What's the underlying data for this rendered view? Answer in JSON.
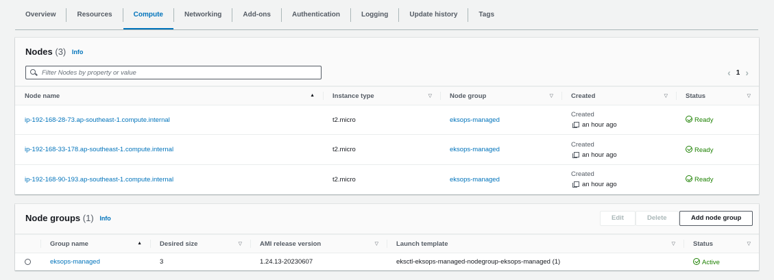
{
  "tabs": [
    {
      "label": "Overview"
    },
    {
      "label": "Resources"
    },
    {
      "label": "Compute",
      "active": true
    },
    {
      "label": "Networking"
    },
    {
      "label": "Add-ons"
    },
    {
      "label": "Authentication"
    },
    {
      "label": "Logging"
    },
    {
      "label": "Update history"
    },
    {
      "label": "Tags"
    }
  ],
  "nodes": {
    "title": "Nodes",
    "count": "(3)",
    "info": "Info",
    "search_placeholder": "Filter Nodes by property or value",
    "page": "1",
    "columns": [
      "Node name",
      "Instance type",
      "Node group",
      "Created",
      "Status"
    ],
    "rows": [
      {
        "name": "ip-192-168-28-73.ap-southeast-1.compute.internal",
        "instance_type": "t2.micro",
        "node_group": "eksops-managed",
        "created_label": "Created",
        "created": "an hour ago",
        "status": "Ready"
      },
      {
        "name": "ip-192-168-33-178.ap-southeast-1.compute.internal",
        "instance_type": "t2.micro",
        "node_group": "eksops-managed",
        "created_label": "Created",
        "created": "an hour ago",
        "status": "Ready"
      },
      {
        "name": "ip-192-168-90-193.ap-southeast-1.compute.internal",
        "instance_type": "t2.micro",
        "node_group": "eksops-managed",
        "created_label": "Created",
        "created": "an hour ago",
        "status": "Ready"
      }
    ]
  },
  "node_groups": {
    "title": "Node groups",
    "count": "(1)",
    "info": "Info",
    "edit_label": "Edit",
    "delete_label": "Delete",
    "add_label": "Add node group",
    "columns": [
      "Group name",
      "Desired size",
      "AMI release version",
      "Launch template",
      "Status"
    ],
    "rows": [
      {
        "name": "eksops-managed",
        "desired_size": "3",
        "ami": "1.24.13-20230607",
        "launch_template": "eksctl-eksops-managed-nodegroup-eksops-managed (1)",
        "status": "Active"
      }
    ]
  },
  "colors": {
    "link": "#0073bb",
    "success": "#1d8102"
  }
}
